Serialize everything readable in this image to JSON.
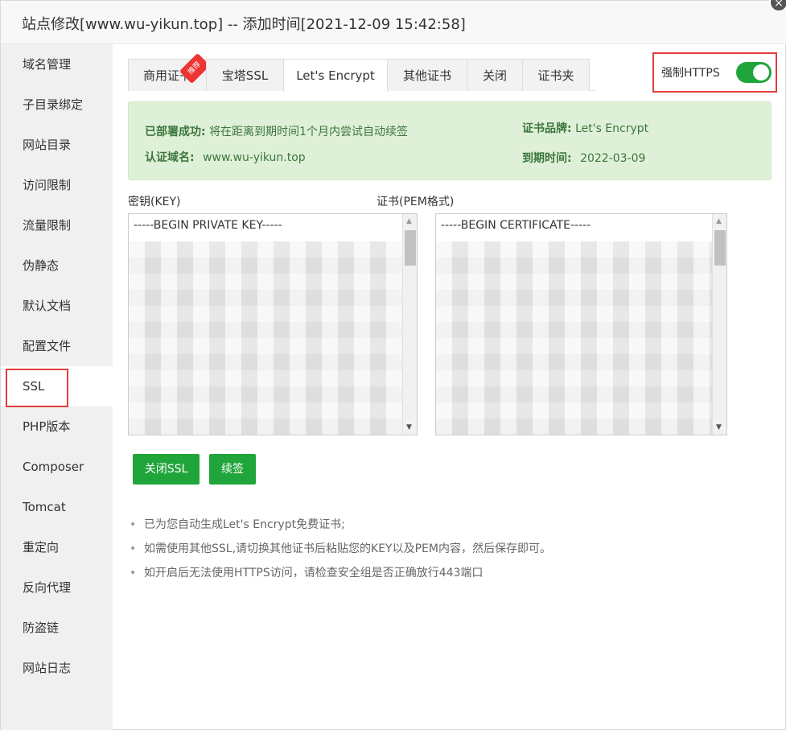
{
  "window": {
    "title": "站点修改[www.wu-yikun.top] -- 添加时间[2021-12-09 15:42:58]",
    "close_glyph": "×"
  },
  "sidebar": {
    "items": [
      {
        "label": "域名管理"
      },
      {
        "label": "子目录绑定"
      },
      {
        "label": "网站目录"
      },
      {
        "label": "访问限制"
      },
      {
        "label": "流量限制"
      },
      {
        "label": "伪静态"
      },
      {
        "label": "默认文档"
      },
      {
        "label": "配置文件"
      },
      {
        "label": "SSL",
        "active": true
      },
      {
        "label": "PHP版本"
      },
      {
        "label": "Composer"
      },
      {
        "label": "Tomcat"
      },
      {
        "label": "重定向"
      },
      {
        "label": "反向代理"
      },
      {
        "label": "防盗链"
      },
      {
        "label": "网站日志"
      }
    ]
  },
  "tabs": {
    "items": [
      {
        "label": "商用证书",
        "badge": "推荐"
      },
      {
        "label": "宝塔SSL"
      },
      {
        "label": "Let's Encrypt",
        "active": true
      },
      {
        "label": "其他证书"
      },
      {
        "label": "关闭"
      },
      {
        "label": "证书夹"
      }
    ]
  },
  "force_https": {
    "label": "强制HTTPS",
    "enabled": true
  },
  "status": {
    "deployed_key": "已部署成功:",
    "deployed_value": "将在距离到期时间1个月内尝试自动续签",
    "brand_key": "证书品牌:",
    "brand_value": "Let's Encrypt",
    "domain_key": "认证域名:",
    "domain_value": "www.wu-yikun.top",
    "expiry_key": "到期时间:",
    "expiry_value": "2022-03-09"
  },
  "key_field": {
    "label": "密钥(KEY)",
    "first_line": "-----BEGIN PRIVATE KEY-----"
  },
  "cert_field": {
    "label": "证书(PEM格式)",
    "first_line": "-----BEGIN CERTIFICATE-----"
  },
  "buttons": {
    "close_ssl": "关闭SSL",
    "renew": "续签"
  },
  "tips": [
    "已为您自动生成Let's Encrypt免费证书;",
    "如需使用其他SSL,请切换其他证书后粘贴您的KEY以及PEM内容，然后保存即可。",
    "如开启后无法使用HTTPS访问，请检查安全组是否正确放行443端口"
  ],
  "colors": {
    "accent_green": "#20a53a",
    "highlight_red": "#e23c3c",
    "alert_bg": "#dff0d8"
  }
}
